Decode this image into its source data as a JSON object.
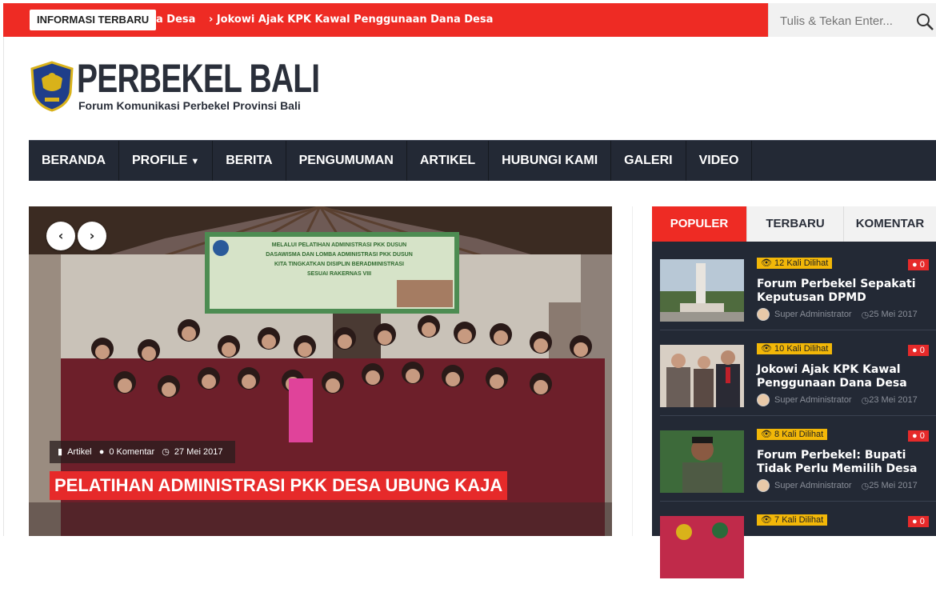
{
  "topbar": {
    "badge": "INFORMASI TERBARU",
    "ticker": [
      "a Desa",
      "› Jokowi Ajak KPK Kawal Penggunaan Dana Desa"
    ],
    "search_placeholder": "Tulis & Tekan Enter...",
    "accent": "#ee2b24"
  },
  "logo": {
    "title": "PERBEKEL BALI",
    "tagline": "Forum Komunikasi Perbekel Provinsi Bali"
  },
  "nav": {
    "items": [
      "BERANDA",
      "PROFILE",
      "BERITA",
      "PENGUMUMAN",
      "ARTIKEL",
      "HUBUNGI KAMI",
      "GALERI",
      "VIDEO"
    ],
    "bg": "#232935"
  },
  "slider": {
    "prev": "‹",
    "next": "›",
    "banner_lines": [
      "MELALUI PELATIHAN ADMINISTRASI PKK DUSUN",
      "DASAWISMA DAN LOMBA ADMINISTRASI PKK DUSUN",
      "KITA TINGKATKAN DISIPLIN BERADMINISTRASI",
      "SESUAI RAKERNAS VIII"
    ],
    "category": "Artikel",
    "comments": "0 Komentar",
    "date": "27 Mei 2017",
    "title": "PELATIHAN ADMINISTRASI PKK DESA UBUNG KAJA"
  },
  "widget": {
    "tabs": [
      "POPULER",
      "TERBARU",
      "KOMENTAR"
    ],
    "active_tab": "POPULER",
    "items": [
      {
        "views": "12 Kali Dilihat",
        "comments": "0",
        "title": "Forum Perbekel Sepakati Keputusan DPMD",
        "author": "Super Administrator",
        "date": "25 Mei 2017",
        "thumb_icon": "monument-photo"
      },
      {
        "views": "10 Kali Dilihat",
        "comments": "0",
        "title": "Jokowi Ajak KPK Kawal Penggunaan Dana Desa",
        "author": "Super Administrator",
        "date": "23 Mei 2017",
        "thumb_icon": "officials-photo"
      },
      {
        "views": "8 Kali Dilihat",
        "comments": "0",
        "title": "Forum Perbekel: Bupati Tidak Perlu Memilih Desa",
        "author": "Super Administrator",
        "date": "25 Mei 2017",
        "thumb_icon": "portrait-photo"
      },
      {
        "views": "7 Kali Dilihat",
        "comments": "0",
        "title": "",
        "author": "",
        "date": "",
        "thumb_icon": "ceremony-photo"
      }
    ]
  }
}
